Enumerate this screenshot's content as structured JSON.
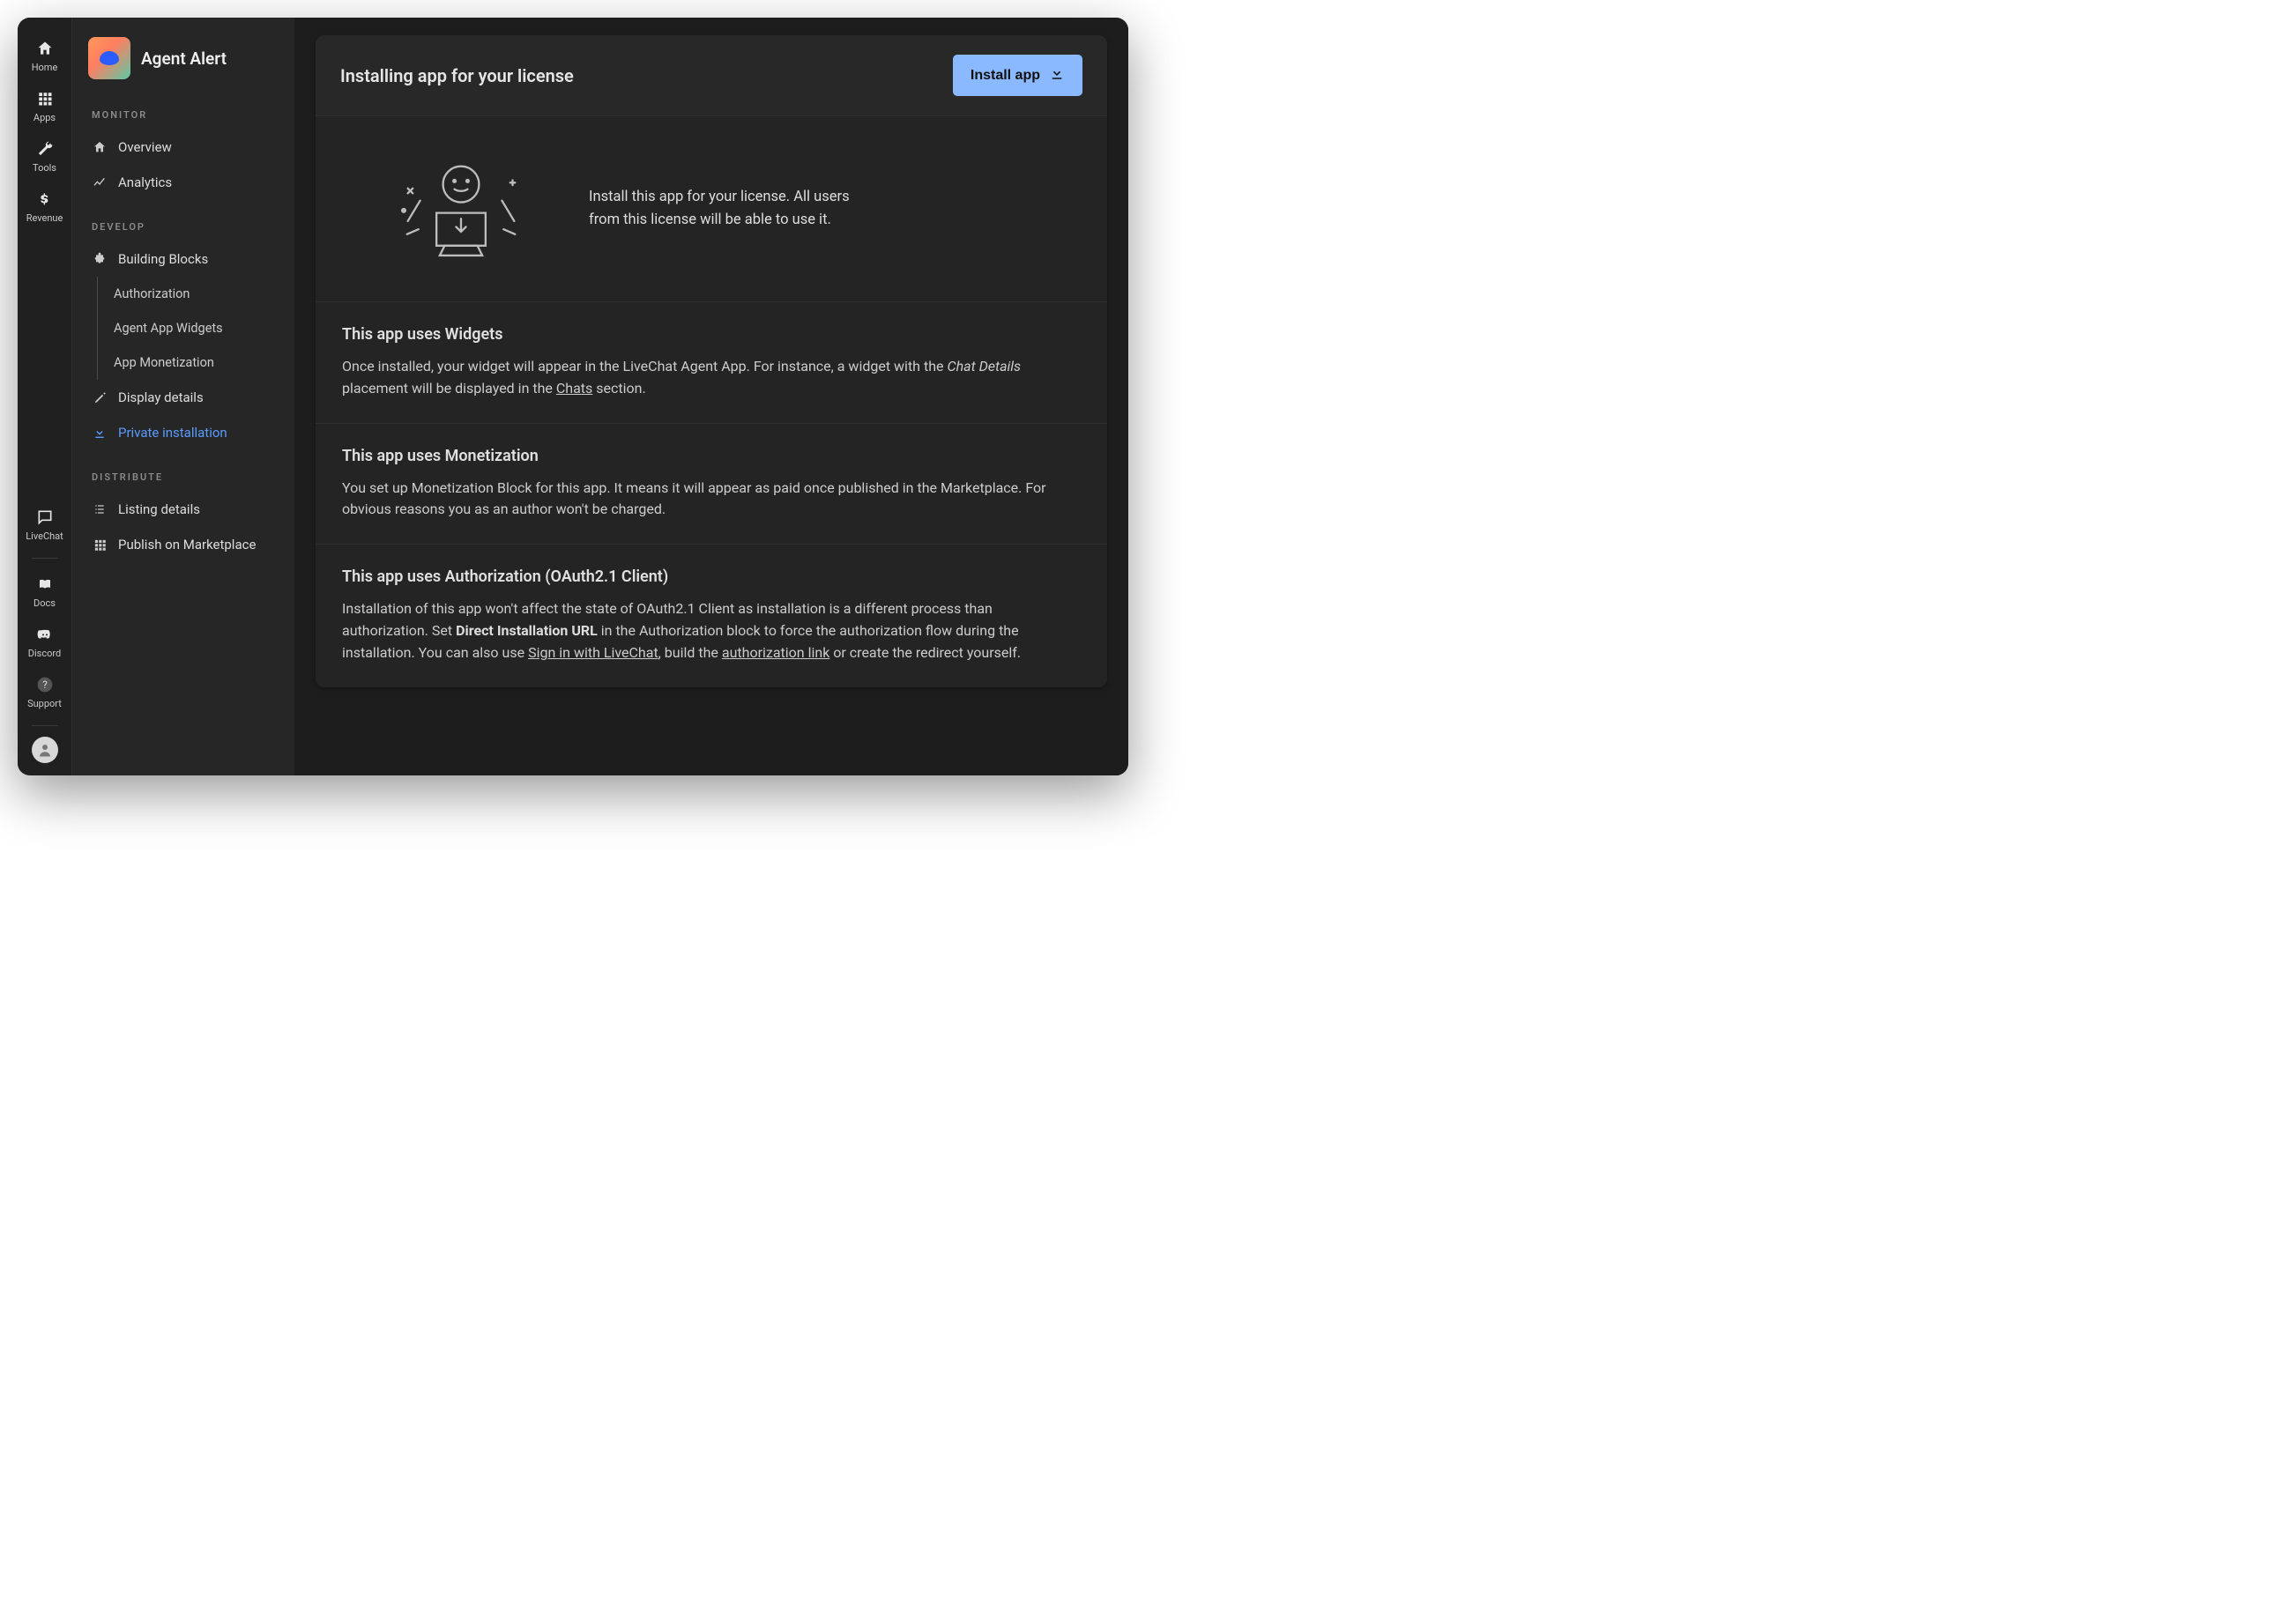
{
  "rail": {
    "top": [
      {
        "id": "home",
        "label": "Home"
      },
      {
        "id": "apps",
        "label": "Apps"
      },
      {
        "id": "tools",
        "label": "Tools"
      },
      {
        "id": "revenue",
        "label": "Revenue"
      }
    ],
    "bottom": [
      {
        "id": "livechat",
        "label": "LiveChat"
      },
      {
        "id": "docs",
        "label": "Docs"
      },
      {
        "id": "discord",
        "label": "Discord"
      },
      {
        "id": "support",
        "label": "Support"
      }
    ]
  },
  "sidebar": {
    "app_name": "Agent Alert",
    "sections": {
      "monitor": {
        "label": "MONITOR",
        "items": [
          "Overview",
          "Analytics"
        ]
      },
      "develop": {
        "label": "DEVELOP",
        "items": [
          "Building Blocks",
          "Display details",
          "Private installation"
        ],
        "sub_blocks": [
          "Authorization",
          "Agent App Widgets",
          "App Monetization"
        ],
        "active": "Private installation"
      },
      "distribute": {
        "label": "DISTRIBUTE",
        "items": [
          "Listing details",
          "Publish on Marketplace"
        ]
      }
    }
  },
  "main": {
    "header_title": "Installing app for your license",
    "install_button": "Install app",
    "intro_text": "Install this app for your license. All users from this license will be able to use it.",
    "sections": [
      {
        "title": "This app uses Widgets",
        "body_parts": [
          "Once installed, your widget will appear in the LiveChat Agent App. For instance, a widget with the ",
          "Chat Details",
          " placement will be displayed in the ",
          "Chats",
          " section."
        ]
      },
      {
        "title": "This app uses Monetization",
        "body": "You set up Monetization Block for this app. It means it will appear as paid once published in the Marketplace. For obvious reasons you as an author won't be charged."
      },
      {
        "title": "This app uses Authorization (OAuth2.1 Client)",
        "body_parts": [
          "Installation of this app won't affect the state of OAuth2.1 Client as installation is a different process than authorization. Set ",
          "Direct Installation URL",
          " in the Authorization block to force the authorization flow during the installation. You can also use ",
          "Sign in with LiveChat",
          ", build the ",
          "authorization link",
          " or create the redirect yourself."
        ]
      }
    ]
  }
}
